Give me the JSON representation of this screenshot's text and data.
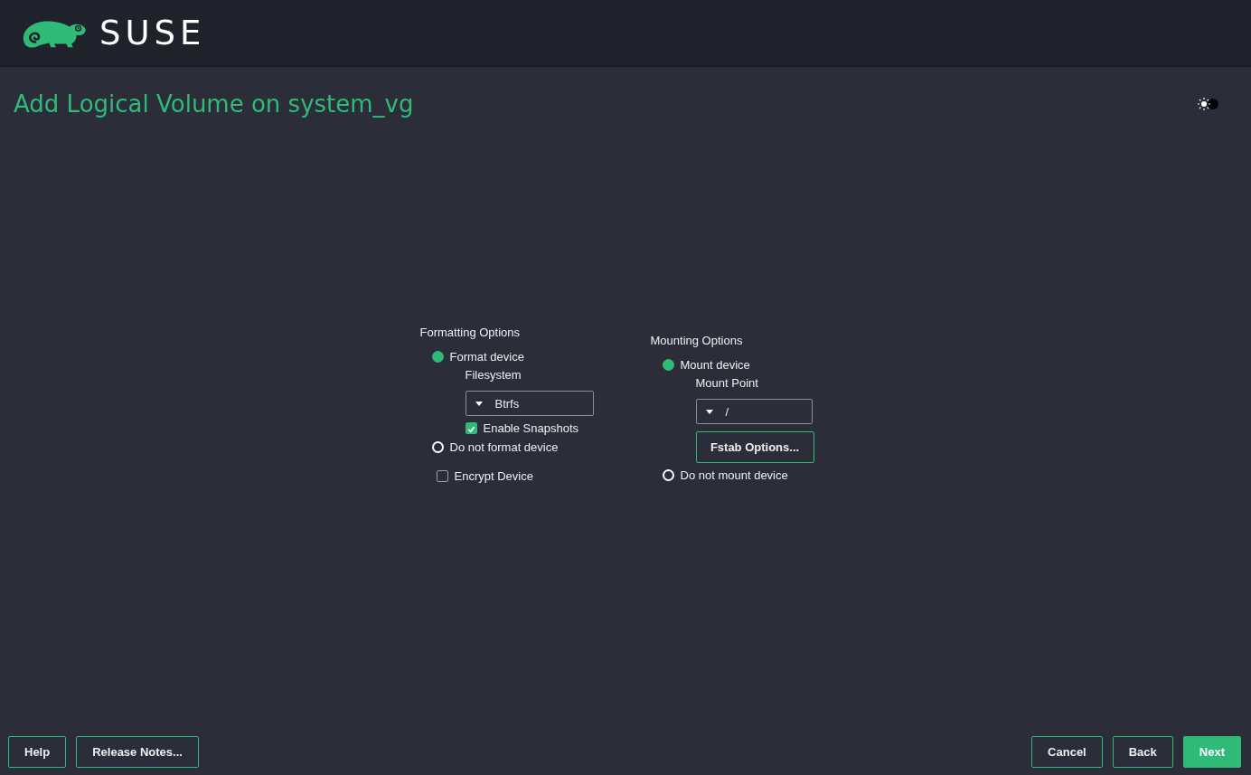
{
  "header": {
    "logo_text": "SUSE"
  },
  "title": "Add Logical Volume on system_vg",
  "formatting": {
    "heading": "Formatting Options",
    "radios": [
      {
        "label": "Format device",
        "selected": true
      },
      {
        "label": "Do not format device",
        "selected": false
      }
    ],
    "filesystem": {
      "label": "Filesystem",
      "value": "Btrfs"
    },
    "snapshots": {
      "label": "Enable Snapshots",
      "checked": true
    },
    "encrypt": {
      "label": "Encrypt Device",
      "checked": false
    }
  },
  "mounting": {
    "heading": "Mounting Options",
    "radios": [
      {
        "label": "Mount device",
        "selected": true
      },
      {
        "label": "Do not mount device",
        "selected": false
      }
    ],
    "mount_point": {
      "label": "Mount Point",
      "value": "/"
    },
    "fstab_button": "Fstab Options..."
  },
  "buttons_left": [
    {
      "label": "Help",
      "primary": false
    },
    {
      "label": "Release Notes...",
      "primary": false
    }
  ],
  "buttons_right": [
    {
      "label": "Cancel",
      "primary": false
    },
    {
      "label": "Back",
      "primary": false
    },
    {
      "label": "Next",
      "primary": true
    }
  ]
}
